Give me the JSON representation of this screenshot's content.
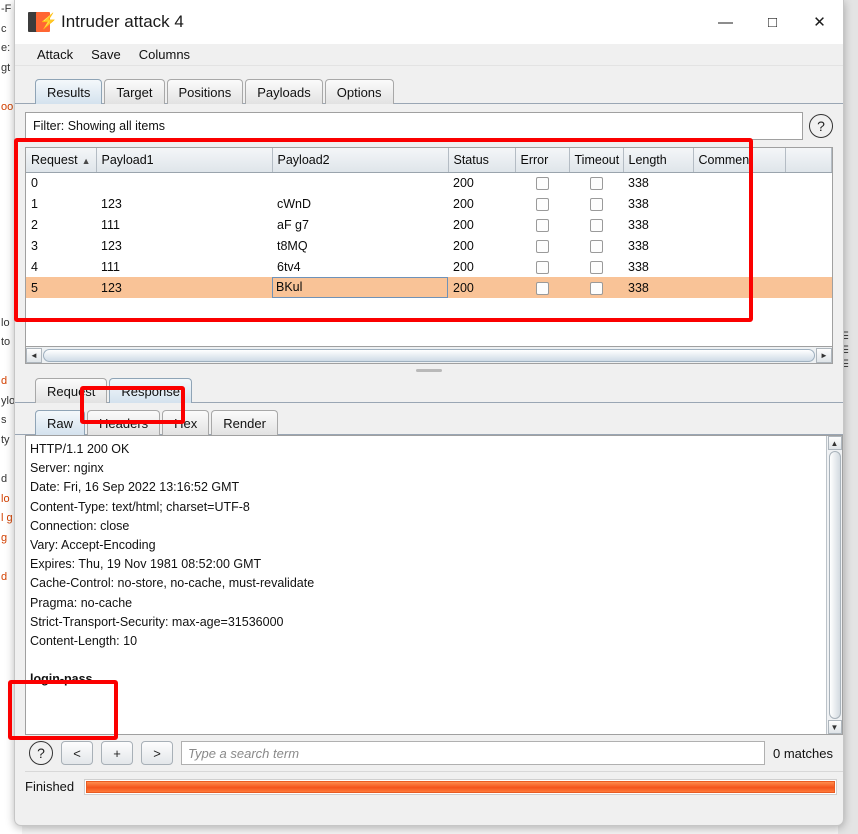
{
  "window": {
    "title": "Intruder attack 4",
    "icon": "burp-suite-icon",
    "minimize": "—",
    "maximize": "□",
    "close": "✕"
  },
  "menu": {
    "items": [
      "Attack",
      "Save",
      "Columns"
    ]
  },
  "main_tabs": {
    "items": [
      "Results",
      "Target",
      "Positions",
      "Payloads",
      "Options"
    ],
    "active": "Results"
  },
  "filter": {
    "label": "Filter: Showing all items",
    "help_icon": "question-mark-icon"
  },
  "results_table": {
    "columns": [
      "Request",
      "Payload1",
      "Payload2",
      "Status",
      "Error",
      "Timeout",
      "Length",
      "Comment"
    ],
    "sort_column": "Request",
    "sort_direction": "▲",
    "rows": [
      {
        "request": "0",
        "payload1": "",
        "payload2": "",
        "status": "200",
        "error": false,
        "timeout": false,
        "length": "338",
        "comment": "",
        "selected": false
      },
      {
        "request": "1",
        "payload1": "123",
        "payload2": "cWnD",
        "status": "200",
        "error": false,
        "timeout": false,
        "length": "338",
        "comment": "",
        "selected": false
      },
      {
        "request": "2",
        "payload1": "111",
        "payload2": "aF g7",
        "status": "200",
        "error": false,
        "timeout": false,
        "length": "338",
        "comment": "",
        "selected": false
      },
      {
        "request": "3",
        "payload1": "123",
        "payload2": "t8MQ",
        "status": "200",
        "error": false,
        "timeout": false,
        "length": "338",
        "comment": "",
        "selected": false
      },
      {
        "request": "4",
        "payload1": "111",
        "payload2": "6tv4",
        "status": "200",
        "error": false,
        "timeout": false,
        "length": "338",
        "comment": "",
        "selected": false
      },
      {
        "request": "5",
        "payload1": "123",
        "payload2": "BKul",
        "status": "200",
        "error": false,
        "timeout": false,
        "length": "338",
        "comment": "",
        "selected": true
      }
    ]
  },
  "message_tabs": {
    "items": [
      "Request",
      "Response"
    ],
    "active": "Response"
  },
  "format_tabs": {
    "items": [
      "Raw",
      "Headers",
      "Hex",
      "Render"
    ],
    "active": "Raw"
  },
  "response": {
    "headers": [
      "HTTP/1.1 200 OK",
      "Server: nginx",
      "Date: Fri, 16 Sep 2022 13:16:52 GMT",
      "Content-Type: text/html; charset=UTF-8",
      "Connection: close",
      "Vary: Accept-Encoding",
      "Expires: Thu, 19 Nov 1981 08:52:00 GMT",
      "Cache-Control: no-store, no-cache, must-revalidate",
      "Pragma: no-cache",
      "Strict-Transport-Security: max-age=31536000",
      "Content-Length: 10"
    ],
    "body": "login-pass"
  },
  "search": {
    "help_icon": "question-mark-icon",
    "prev_label": "<",
    "add_label": "+",
    "next_label": ">",
    "placeholder": "Type a search term",
    "value": "",
    "matches": "0 matches"
  },
  "status": {
    "label": "Finished",
    "progress_percent": 100
  },
  "scrollbars": {
    "left_arrow": "◄",
    "right_arrow": "►",
    "up_arrow": "▲",
    "down_arrow": "▼"
  },
  "colors": {
    "accent_orange": "#ff6633",
    "selection_orange": "#f9c397",
    "annotation_red": "#fb0000",
    "progress_orange": "#f4531b"
  },
  "annotations": [
    {
      "name": "results-table-highlight"
    },
    {
      "name": "response-tab-highlight"
    },
    {
      "name": "response-body-highlight"
    }
  ],
  "background": {
    "left_fragments": [
      "-F",
      "c",
      "e:",
      "gt",
      "",
      "oo",
      "",
      "",
      "",
      "",
      "",
      "",
      "",
      "",
      "",
      "",
      "lo",
      "to",
      "",
      "d",
      "ylo",
      "s",
      "ty",
      "",
      "d",
      "lo",
      "l g",
      "g",
      "",
      "d"
    ]
  }
}
